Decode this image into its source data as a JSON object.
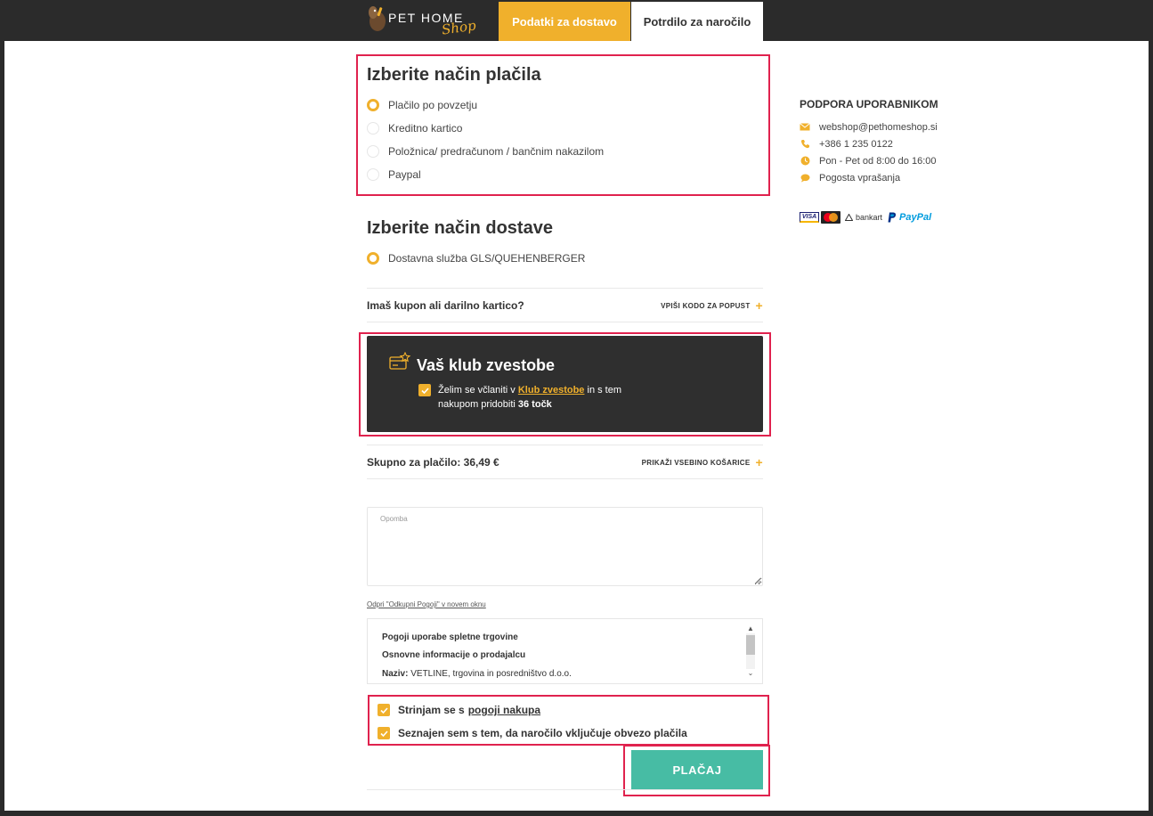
{
  "header": {
    "logo_text": "PET HOME",
    "logo_script": "Shop",
    "tabs": [
      {
        "label": "Podatki za dostavo"
      },
      {
        "label": "Potrdilo za naročilo"
      }
    ]
  },
  "payment": {
    "title": "Izberite način plačila",
    "options": [
      {
        "label": "Plačilo po povzetju",
        "selected": true
      },
      {
        "label": "Kreditno kartico",
        "selected": false
      },
      {
        "label": "Položnica/ predračunom / bančnim nakazilom",
        "selected": false
      },
      {
        "label": "Paypal",
        "selected": false
      }
    ]
  },
  "delivery": {
    "title": "Izberite način dostave",
    "options": [
      {
        "label": "Dostavna služba GLS/QUEHENBERGER",
        "selected": true
      }
    ]
  },
  "coupon": {
    "label": "Imaš kupon ali darilno kartico?",
    "action": "VPIŠI KODO ZA POPUST"
  },
  "club": {
    "title": "Vaš klub zvestobe",
    "text_before": "Želim se včlaniti v ",
    "link": "Klub zvestobe",
    "text_middle": " in s tem nakupom pridobiti ",
    "points": "36 točk"
  },
  "total": {
    "label": "Skupno za plačilo: 36,49 €",
    "action": "PRIKAŽI VSEBINO KOŠARICE"
  },
  "note": {
    "placeholder": "Opomba"
  },
  "terms": {
    "link": "Odpri \"Odkupni Pogoji\" v novem oknu",
    "line1": "Pogoji uporabe spletne trgovine",
    "line2": "Osnovne informacije o prodajalcu",
    "line3_label": "Naziv:",
    "line3_value": " VETLINE, trgovina in posredništvo d.o.o."
  },
  "agreements": {
    "agree1_text": "Strinjam se s",
    "agree1_link": "pogoji nakupa",
    "agree2_text": "Seznajen sem s tem, da naročilo vključuje obvezo plačila"
  },
  "pay_button": "PLAČAJ",
  "support": {
    "title": "PODPORA UPORABNIKOM",
    "email": "webshop@pethomeshop.si",
    "phone": "+386 1 235 0122",
    "hours": "Pon - Pet od 8:00 do 16:00",
    "faq": "Pogosta vprašanja"
  },
  "payment_logos": {
    "visa": "VISA",
    "bankart": "bankart",
    "paypal_a": "Pay",
    "paypal_b": "Pal"
  },
  "colors": {
    "accent": "#f0b02c",
    "pay_button": "#47bca4",
    "highlight": "#e0224e",
    "dark": "#2b2b2b"
  }
}
